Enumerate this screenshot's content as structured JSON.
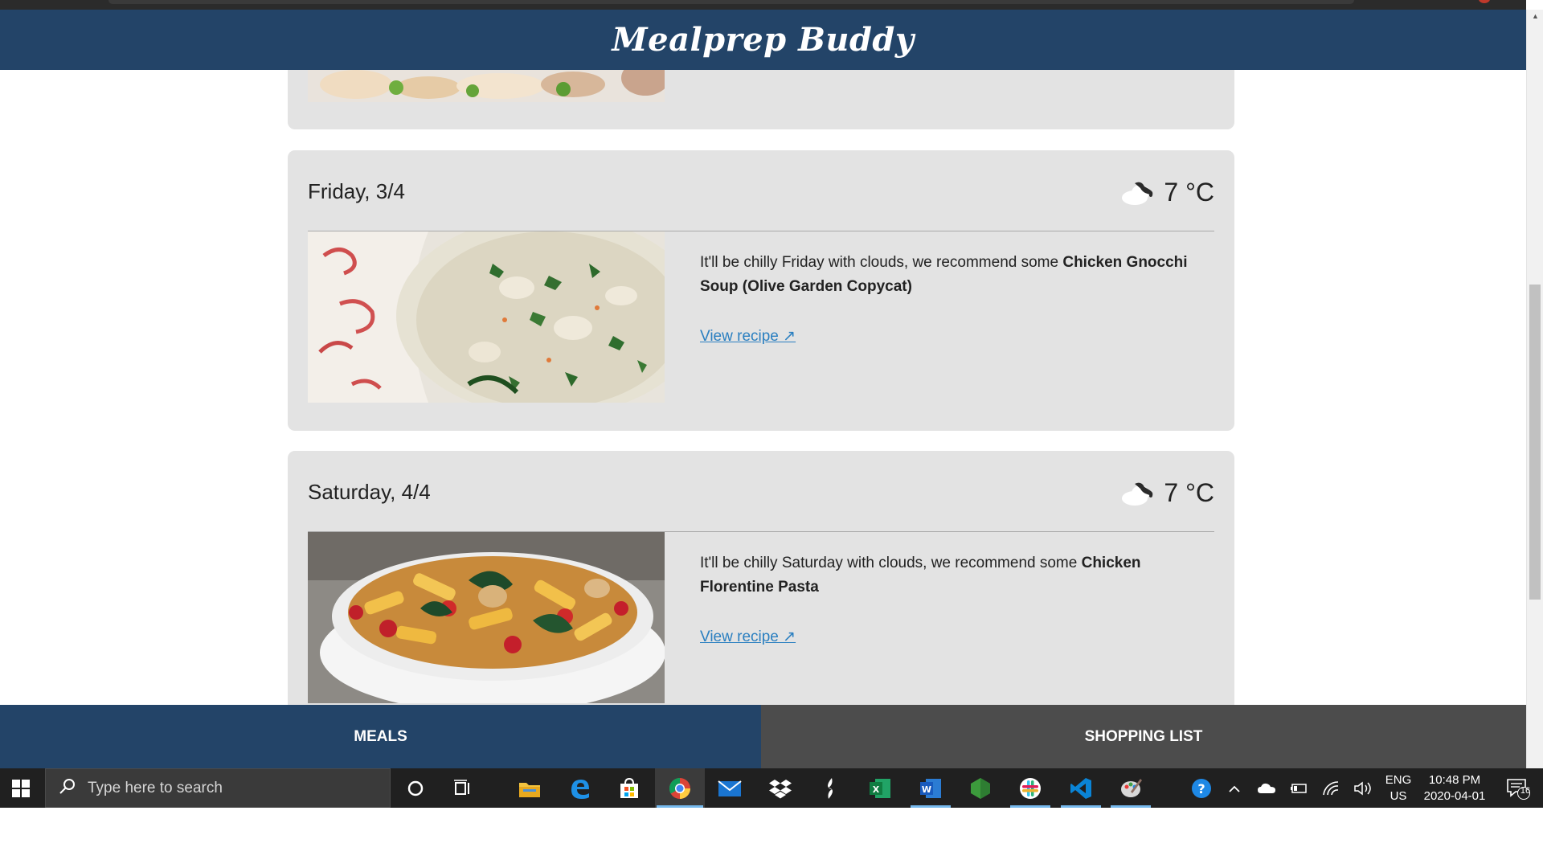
{
  "app": {
    "title": "Mealprep Buddy"
  },
  "days": [
    {
      "day": "Friday, 3/4",
      "temp": "7 °C",
      "weather_icon": "cloudy-night-icon",
      "text_prefix": "It'll be chilly Friday with clouds, we recommend some ",
      "meal": "Chicken Gnocchi Soup (Olive Garden Copycat)",
      "link": "View recipe ↗"
    },
    {
      "day": "Saturday, 4/4",
      "temp": "7 °C",
      "weather_icon": "cloudy-night-icon",
      "text_prefix": "It'll be chilly Saturday with clouds, we recommend some ",
      "meal": "Chicken Florentine Pasta",
      "link": "View recipe ↗"
    }
  ],
  "nav": {
    "meals": "MEALS",
    "shopping": "SHOPPING LIST",
    "active": "meals"
  },
  "taskbar": {
    "search_placeholder": "Type here to search",
    "apps": [
      "windows-start-icon",
      "cortana-icon",
      "task-view-icon",
      "file-explorer-icon",
      "edge-icon",
      "store-icon",
      "chrome-icon",
      "mail-icon",
      "dropbox-icon",
      "app-icon",
      "excel-icon",
      "word-icon",
      "nodejs-icon",
      "slack-icon",
      "vscode-icon",
      "paint-icon"
    ],
    "lang": "ENG",
    "region": "US",
    "time": "10:48 PM",
    "date": "2020-04-01",
    "notifications": "16"
  },
  "colors": {
    "header": "#234468",
    "nav_active": "#234468",
    "nav_inactive": "#4c4c4c",
    "card": "#e3e3e3",
    "link": "#2a7fc0"
  }
}
